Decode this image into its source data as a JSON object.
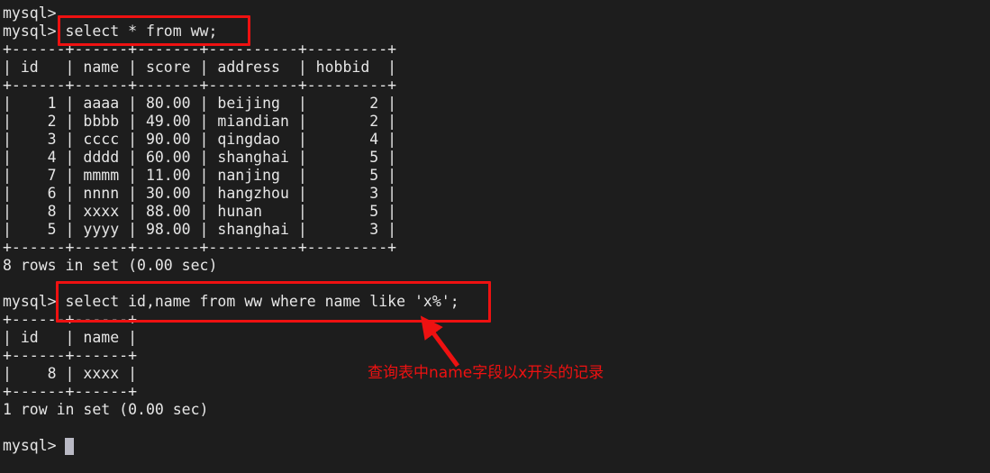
{
  "terminal": {
    "background_color": "#1d1d1d",
    "text_color": "#e6e6e6",
    "prompt": "mysql>",
    "lines": [
      "mysql>",
      "mysql> select * from ww;",
      "+------+------+-------+----------+---------+",
      "| id   | name | score | address  | hobbid  |",
      "+------+------+-------+----------+---------+",
      "|    1 | aaaa | 80.00 | beijing  |       2 |",
      "|    2 | bbbb | 49.00 | miandian |       2 |",
      "|    3 | cccc | 90.00 | qingdao  |       4 |",
      "|    4 | dddd | 60.00 | shanghai |       5 |",
      "|    7 | mmmm | 11.00 | nanjing  |       5 |",
      "|    6 | nnnn | 30.00 | hangzhou |       3 |",
      "|    8 | xxxx | 88.00 | hunan    |       5 |",
      "|    5 | yyyy | 98.00 | shanghai |       3 |",
      "+------+------+-------+----------+---------+",
      "8 rows in set (0.00 sec)",
      "",
      "mysql> select id,name from ww where name like 'x%';",
      "+------+------+",
      "| id   | name |",
      "+------+------+",
      "|    8 | xxxx |",
      "+------+------+",
      "1 row in set (0.00 sec)",
      "",
      "mysql> "
    ]
  },
  "queries": {
    "first": "select * from ww;",
    "second": "select id,name from ww where name like 'x%';"
  },
  "results": {
    "table1": {
      "columns": [
        "id",
        "name",
        "score",
        "address",
        "hobbid"
      ],
      "rows": [
        [
          "1",
          "aaaa",
          "80.00",
          "beijing",
          "2"
        ],
        [
          "2",
          "bbbb",
          "49.00",
          "miandian",
          "2"
        ],
        [
          "3",
          "cccc",
          "90.00",
          "qingdao",
          "4"
        ],
        [
          "4",
          "dddd",
          "60.00",
          "shanghai",
          "5"
        ],
        [
          "7",
          "mmmm",
          "11.00",
          "nanjing",
          "5"
        ],
        [
          "6",
          "nnnn",
          "30.00",
          "hangzhou",
          "3"
        ],
        [
          "8",
          "xxxx",
          "88.00",
          "hunan",
          "5"
        ],
        [
          "5",
          "yyyy",
          "98.00",
          "shanghai",
          "3"
        ]
      ],
      "status": "8 rows in set (0.00 sec)"
    },
    "table2": {
      "columns": [
        "id",
        "name"
      ],
      "rows": [
        [
          "8",
          "xxxx"
        ]
      ],
      "status": "1 row in set (0.00 sec)"
    }
  },
  "annotations": {
    "color": "#ee1111",
    "note_text": "查询表中name字段以x开头的记录",
    "highlight_1_target": "select * from ww;",
    "highlight_2_target": "select id,name from ww where name like 'x%';"
  }
}
